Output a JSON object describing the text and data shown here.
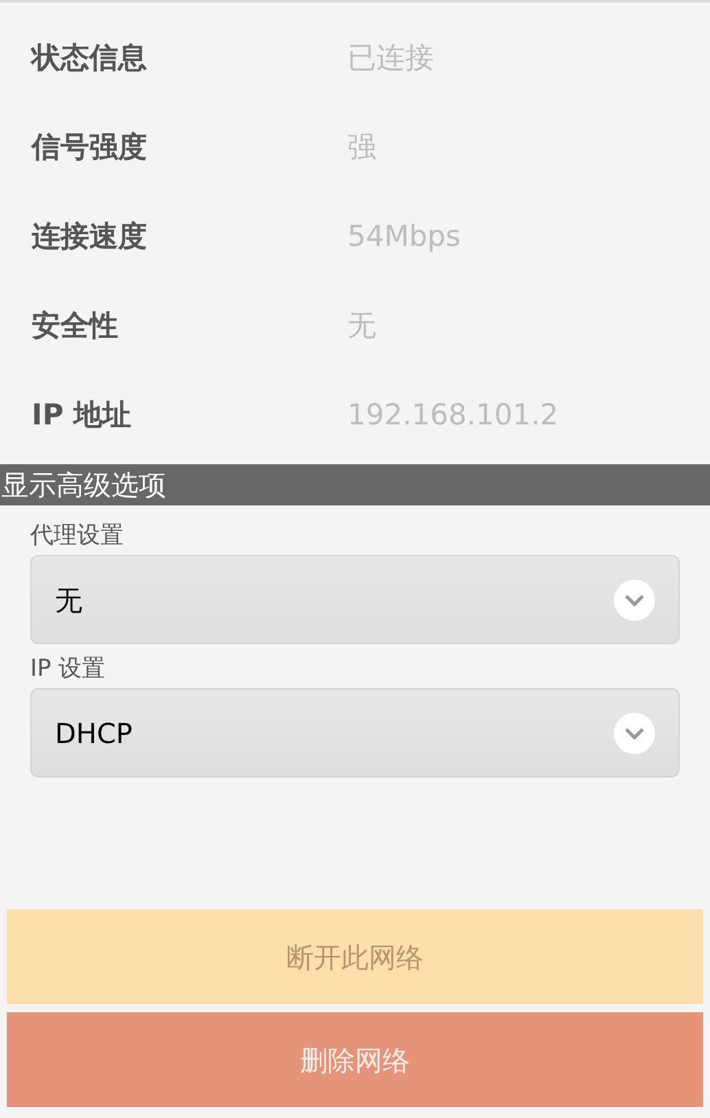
{
  "info_rows": [
    {
      "label": "状态信息",
      "value": "已连接"
    },
    {
      "label": "信号强度",
      "value": "强"
    },
    {
      "label": "连接速度",
      "value": "54Mbps"
    },
    {
      "label": "安全性",
      "value": "无"
    },
    {
      "label": "IP 地址",
      "value": "192.168.101.2"
    }
  ],
  "advanced_header": "显示高级选项",
  "settings": [
    {
      "label": "代理设置",
      "value": "无"
    },
    {
      "label": "IP 设置",
      "value": "DHCP"
    }
  ],
  "buttons": [
    {
      "label": "断开此网络",
      "disabled": true
    },
    {
      "label": "删除网络",
      "disabled": false
    }
  ]
}
